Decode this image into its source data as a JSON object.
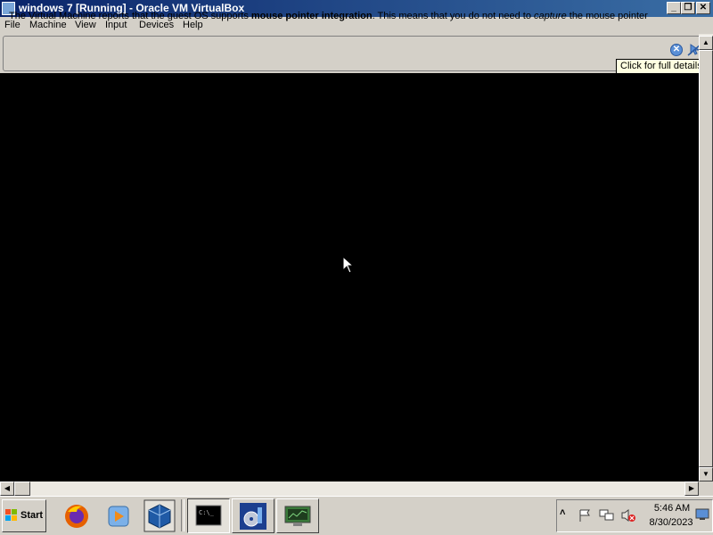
{
  "window": {
    "title": "windows 7 [Running] - Oracle VM VirtualBox",
    "controls": {
      "minimize": "_",
      "restore": "❐",
      "close": "✕"
    }
  },
  "menu": {
    "items": [
      "File",
      "Machine",
      "View",
      "Input",
      "Devices",
      "Help"
    ]
  },
  "notification": {
    "text_before": "The Virtual Machine reports that the guest OS supports ",
    "text_bold": "mouse pointer integration",
    "text_middle": ". This means that you do not need to ",
    "text_italic": "capture",
    "text_after": " the mouse pointer",
    "tooltip": "Click for full details",
    "icons": [
      "info-close-icon",
      "mouse-integration-icon"
    ]
  },
  "scrollbars": {
    "up": "▲",
    "down": "▼",
    "left": "◀",
    "right": "▶"
  },
  "taskbar": {
    "start_label": "Start",
    "quick_launch": [
      "firefox-icon",
      "media-player-icon",
      "virtualbox-icon"
    ],
    "windows": [
      "command-prompt-icon",
      "media-center-icon",
      "network-manager-icon"
    ],
    "tray_icons": [
      "show-hidden-icon",
      "action-center-flag-icon",
      "network-icon",
      "volume-muted-icon"
    ],
    "clock": {
      "time": "5:46 AM",
      "date": "8/30/2023"
    }
  },
  "colors": {
    "titlebar_start": "#0a246a",
    "titlebar_end": "#3a6ea5",
    "screen": "#000000",
    "tooltip_bg": "#ffffe1"
  }
}
